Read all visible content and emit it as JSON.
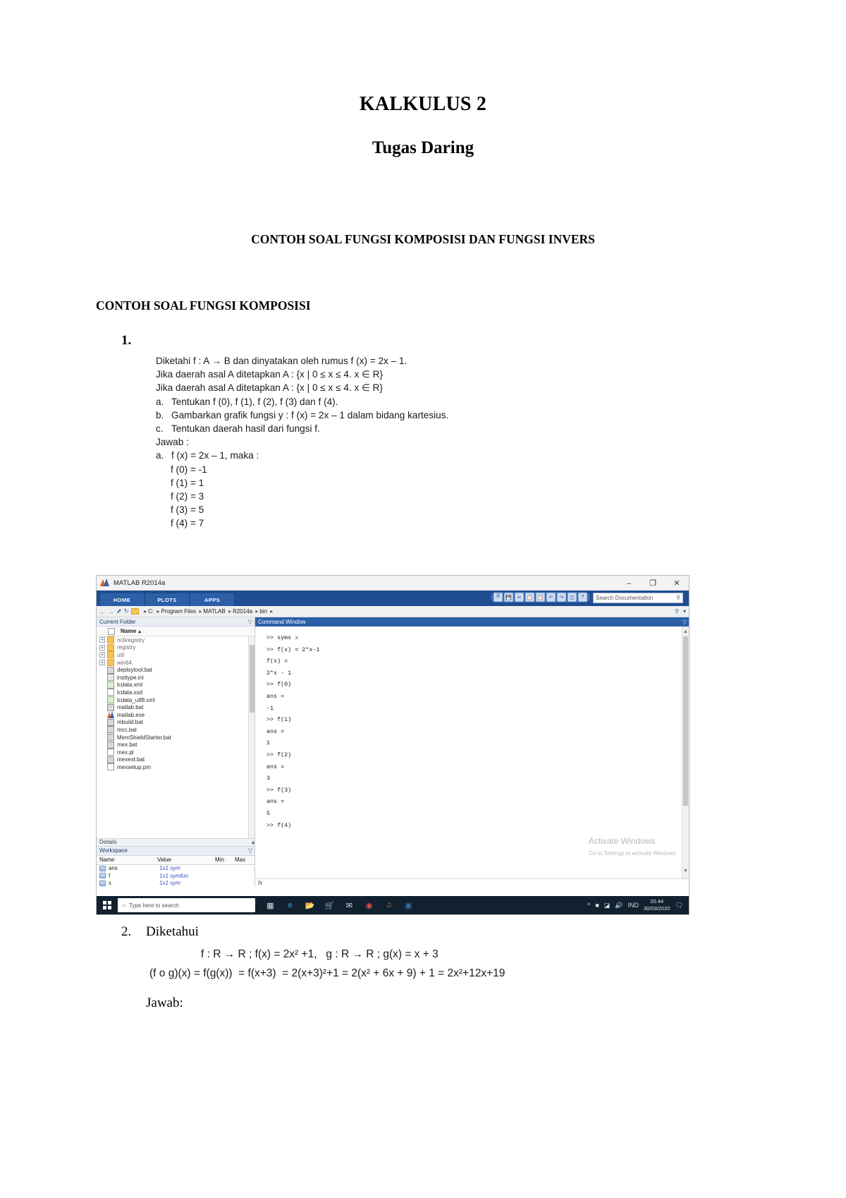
{
  "document": {
    "title": "KALKULUS 2",
    "subtitle": "Tugas Daring",
    "section_center": "CONTOH SOAL FUNGSI KOMPOSISI DAN FUNGSI INVERS",
    "section_left": "CONTOH SOAL FUNGSI KOMPOSISI",
    "item_number_1": "1.",
    "problem1": {
      "lines": [
        "Diketahi f : A → B dan dinyatakan oleh rumus f (x) = 2x – 1.",
        "Jika daerah asal A ditetapkan A : {x | 0 ≤ x ≤ 4. x ∈ R}",
        "Jika daerah asal A ditetapkan A : {x | 0 ≤ x ≤ 4. x ∈ R}"
      ],
      "sub_a": "Tentukan f (0), f (1), f (2), f (3) dan f (4).",
      "sub_b": "Gambarkan grafik fungsi y : f (x) = 2x – 1 dalam bidang kartesius.",
      "sub_c": "Tentukan daerah hasil dari fungsi f.",
      "label_a": "a.",
      "label_b": "b.",
      "label_c": "c.",
      "jawab_label": "Jawab :",
      "answer_a": "f (x) = 2x – 1, maka :",
      "values": [
        "f (0) = -1",
        "f (1) = 1",
        "f (2) = 3",
        "f (3) = 5",
        "f (4) = 7"
      ]
    },
    "problem2": {
      "number": "2.",
      "heading": "Diketahui",
      "line1": "f : R → R ; f(x) = 2x² +1,   g : R → R ; g(x) = x + 3",
      "line2": "(f o g)(x) = f(g(x))  = f(x+3)  = 2(x+3)²+1 = 2(x² + 6x + 9) + 1 = 2x²+12x+19",
      "jawab": "Jawab:"
    }
  },
  "matlab": {
    "window_title": "MATLAB R2014a",
    "window_controls": {
      "minimize": "–",
      "restore": "❐",
      "close": "✕"
    },
    "ribbon_tabs": [
      "HOME",
      "PLOTS",
      "APPS"
    ],
    "quick_access_icons": [
      "new-script-icon",
      "save-icon",
      "cut-icon",
      "copy-icon",
      "paste-icon",
      "undo-icon",
      "redo-icon",
      "switch-window-icon",
      "help-icon"
    ],
    "search_documentation": {
      "placeholder": "Search Documentation",
      "magnifier": "⚲",
      "caret": "▾"
    },
    "address_bar": {
      "back": "←",
      "forward": "→",
      "up": "⬆",
      "refresh": "↻",
      "crumbs": [
        "C:",
        "Program Files",
        "MATLAB",
        "R2014a",
        "bin"
      ],
      "separator": "▸"
    },
    "current_folder": {
      "panel_title": "Current Folder",
      "column_name": "Name",
      "sort_arrow": "▴",
      "files": [
        {
          "name": "m3iregistry",
          "type": "folder",
          "expandable": true
        },
        {
          "name": "registry",
          "type": "folder",
          "expandable": true
        },
        {
          "name": "util",
          "type": "folder",
          "expandable": true
        },
        {
          "name": "win64",
          "type": "folder",
          "expandable": true
        },
        {
          "name": "deploytool.bat",
          "type": "bat",
          "expandable": false
        },
        {
          "name": "insttype.ini",
          "type": "ini",
          "expandable": false
        },
        {
          "name": "lcdata.xml",
          "type": "xml",
          "expandable": false
        },
        {
          "name": "lcdata.xsd",
          "type": "doc",
          "expandable": false
        },
        {
          "name": "lcdata_utf8.xml",
          "type": "xml",
          "expandable": false
        },
        {
          "name": "matlab.bat",
          "type": "bat",
          "expandable": false
        },
        {
          "name": "matlab.exe",
          "type": "exe",
          "expandable": false
        },
        {
          "name": "mbuild.bat",
          "type": "bat",
          "expandable": false
        },
        {
          "name": "mcc.bat",
          "type": "bat",
          "expandable": false
        },
        {
          "name": "MemShieldStarter.bat",
          "type": "bat",
          "expandable": false
        },
        {
          "name": "mex.bat",
          "type": "bat",
          "expandable": false
        },
        {
          "name": "mex.pl",
          "type": "doc",
          "expandable": false
        },
        {
          "name": "mexext.bat",
          "type": "bat",
          "expandable": false
        },
        {
          "name": "mexsetup.pm",
          "type": "doc",
          "expandable": false
        }
      ]
    },
    "details_bar": "Details",
    "workspace": {
      "panel_title": "Workspace",
      "columns": [
        "Name",
        "Value",
        "Min",
        "Max"
      ],
      "sort_arrow": "▴",
      "rows": [
        {
          "name": "ans",
          "value": "1x1 sym",
          "min": "",
          "max": ""
        },
        {
          "name": "f",
          "value": "1x1 symfun",
          "min": "",
          "max": ""
        },
        {
          "name": "x",
          "value": "1x1 sym",
          "min": "",
          "max": ""
        }
      ]
    },
    "command_window": {
      "panel_title": "Command Window",
      "lines": [
        ">> syms x",
        ">> f(x) = 2*x-1",
        "",
        "f(x) =",
        "",
        "2*x - 1",
        "",
        ">> f(0)",
        "",
        "ans =",
        "",
        "-1",
        "",
        ">> f(1)",
        "",
        "ans =",
        "",
        "1",
        "",
        ">> f(2)",
        "",
        "ans =",
        "",
        "3",
        "",
        ">> f(3)",
        "",
        "ans =",
        "",
        "5",
        "",
        ">> f(4)"
      ],
      "prompt_symbol": "fx"
    },
    "activate_windows": {
      "title": "Activate Windows",
      "subtitle": "Go to Settings to activate Windows."
    },
    "taskbar": {
      "search_placeholder": "Type here to search",
      "search_icon": "○",
      "task_view_icon": "task-view-icon",
      "apps": [
        "edge-icon",
        "file-explorer-icon",
        "store-icon",
        "mail-icon",
        "chrome-icon",
        "media-player-icon",
        "word-icon"
      ],
      "tray": [
        "show-hidden-icons",
        "network-icon",
        "sound-icon"
      ],
      "language": "IND",
      "time": "20.44",
      "date": "30/03/2020",
      "notification_icon": "notifications-icon"
    }
  },
  "colors": {
    "matlab_blue": "#2b5fa8",
    "ribbon_dark": "#1f4d8f",
    "taskbar": "#12212f",
    "folder_yellow": "#f5c451",
    "workspace_value": "#3b4cc0"
  }
}
